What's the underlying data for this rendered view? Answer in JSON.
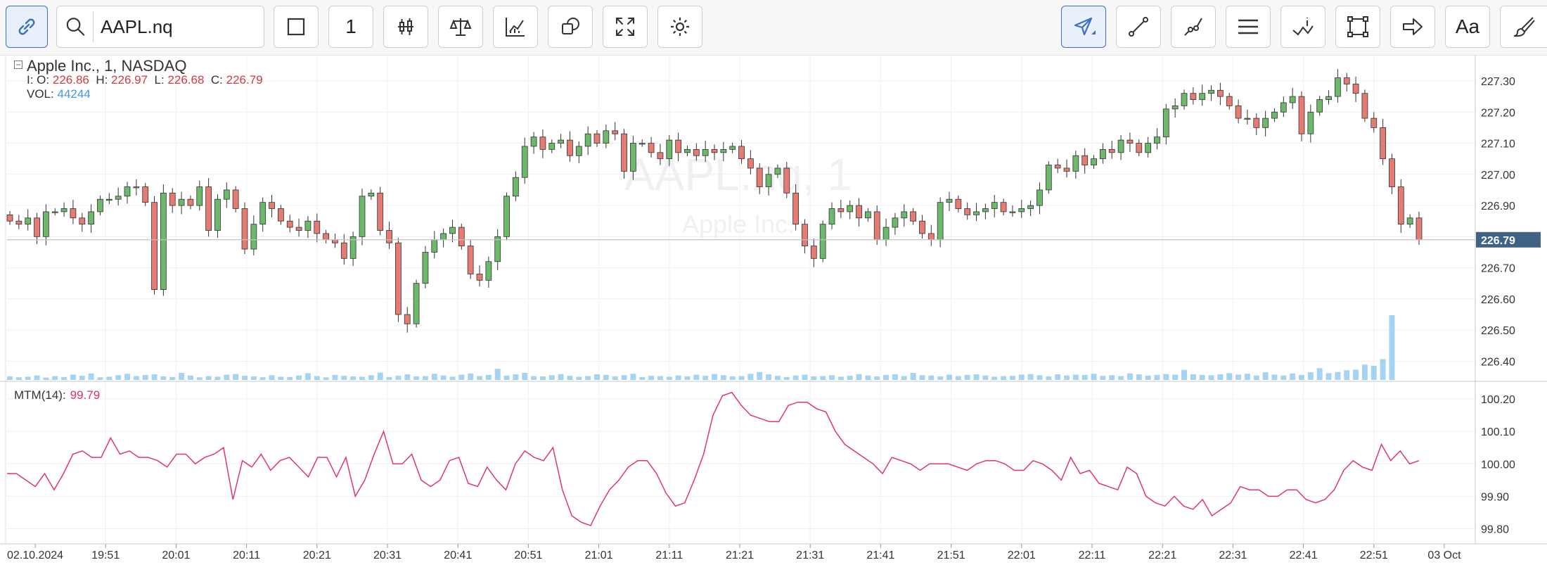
{
  "toolbar": {
    "symbol_value": "AAPL.nq",
    "interval_label": "1",
    "buttons": [
      {
        "name": "link-icon"
      },
      {
        "name": "search-icon"
      },
      {
        "name": "square-icon"
      },
      {
        "name": "candlestick-icon"
      },
      {
        "name": "scale-icon"
      },
      {
        "name": "indicators-icon"
      },
      {
        "name": "shapes-icon"
      },
      {
        "name": "fullscreen-icon"
      },
      {
        "name": "gear-icon"
      },
      {
        "name": "cursor-icon"
      },
      {
        "name": "line-icon"
      },
      {
        "name": "polyline-icon"
      },
      {
        "name": "lines-icon"
      },
      {
        "name": "info-line-icon"
      },
      {
        "name": "rectangle-icon"
      },
      {
        "name": "arrow-icon"
      },
      {
        "name": "text-icon"
      },
      {
        "name": "brush-icon"
      }
    ],
    "text_label": "Aa"
  },
  "legend": {
    "title": "Apple Inc.,  1,  NASDAQ",
    "ohlc_prefix": "I: O:",
    "open": "226.86",
    "high_label": "H:",
    "high": "226.97",
    "low_label": "L:",
    "low": "226.68",
    "close_label": "C:",
    "close": "226.79",
    "vol_label": "VOL:",
    "vol": "44244"
  },
  "watermark": {
    "symbol": "AAPL.nq, 1",
    "name": "Apple Inc."
  },
  "mtm": {
    "label": "MTM(14):",
    "value": "99.79"
  },
  "colors": {
    "up": "#6cb96c",
    "down": "#e57b73",
    "volume": "#8fc9f0",
    "mtm": "#e0366e",
    "accent": "#3e6fc2",
    "price_tag": "#3f6285"
  },
  "chart_data": [
    {
      "type": "candlestick",
      "title": "Apple Inc., 1, NASDAQ",
      "y_ticks": [
        "227.30",
        "227.20",
        "227.10",
        "227.00",
        "226.90",
        "226.80",
        "226.70",
        "226.60",
        "226.50",
        "226.40"
      ],
      "ylim": [
        226.34,
        227.37
      ],
      "last_price": "226.79",
      "x_ticks": [
        "02.10.2024",
        "19:51",
        "20:01",
        "20:11",
        "20:21",
        "20:31",
        "20:41",
        "20:51",
        "21:01",
        "21:11",
        "21:21",
        "21:31",
        "21:41",
        "21:51",
        "22:01",
        "22:11",
        "22:21",
        "22:31",
        "22:41",
        "22:51",
        "03 Oct"
      ],
      "close": [
        226.85,
        226.84,
        226.86,
        226.8,
        226.88,
        226.88,
        226.89,
        226.86,
        226.84,
        226.88,
        226.92,
        226.92,
        226.93,
        226.96,
        226.96,
        226.91,
        226.63,
        226.94,
        226.9,
        226.92,
        226.9,
        226.96,
        226.82,
        226.92,
        226.95,
        226.89,
        226.76,
        226.84,
        226.91,
        226.89,
        226.85,
        226.83,
        226.82,
        226.85,
        226.81,
        226.79,
        226.78,
        226.73,
        226.8,
        226.93,
        226.94,
        226.82,
        226.78,
        226.55,
        226.52,
        226.65,
        226.75,
        226.79,
        226.81,
        226.83,
        226.77,
        226.68,
        226.66,
        226.72,
        226.8,
        226.93,
        226.99,
        227.09,
        227.12,
        227.08,
        227.1,
        227.11,
        227.06,
        227.09,
        227.13,
        227.1,
        227.14,
        227.13,
        227.01,
        227.1,
        227.1,
        227.07,
        227.05,
        227.11,
        227.07,
        227.08,
        227.06,
        227.08,
        227.07,
        227.08,
        227.09,
        227.05,
        227.02,
        226.96,
        227.0,
        227.02,
        226.94,
        226.84,
        226.77,
        226.73,
        226.84,
        226.89,
        226.88,
        226.9,
        226.86,
        226.88,
        226.79,
        226.83,
        226.86,
        226.88,
        226.85,
        226.81,
        226.79,
        226.91,
        226.92,
        226.89,
        226.87,
        226.88,
        226.89,
        226.91,
        226.88,
        226.88,
        226.89,
        226.9,
        226.95,
        227.03,
        227.02,
        227.01,
        227.06,
        227.03,
        227.05,
        227.08,
        227.07,
        227.11,
        227.1,
        227.07,
        227.1,
        227.12,
        227.21,
        227.22,
        227.26,
        227.24,
        227.26,
        227.27,
        227.25,
        227.22,
        227.18,
        227.18,
        227.15,
        227.18,
        227.2,
        227.23,
        227.25,
        227.13,
        227.2,
        227.24,
        227.25,
        227.31,
        227.29,
        227.26,
        227.18,
        227.15,
        227.05,
        226.96,
        226.84,
        226.86,
        226.79
      ],
      "volume": [
        1200,
        900,
        1100,
        1500,
        800,
        1300,
        1000,
        1800,
        1400,
        2200,
        900,
        1100,
        1600,
        2100,
        1300,
        1700,
        1900,
        1200,
        1000,
        2400,
        1500,
        900,
        1300,
        1100,
        1800,
        2000,
        1400,
        1200,
        900,
        1600,
        1100,
        1000,
        1500,
        2300,
        1300,
        900,
        1700,
        1400,
        1200,
        1100,
        1600,
        2500,
        1000,
        1400,
        1900,
        1200,
        1300,
        2100,
        1500,
        1100,
        1800,
        2200,
        1300,
        1700,
        3800,
        1500,
        1900,
        2400,
        1300,
        1200,
        1600,
        2000,
        1400,
        1100,
        1300,
        1900,
        1700,
        1200,
        1600,
        2100,
        1000,
        1400,
        1300,
        1100,
        1500,
        1200,
        1800,
        1400,
        2000,
        1600,
        1200,
        1300,
        2100,
        2700,
        1900,
        1400,
        1000,
        1500,
        1800,
        1200,
        1300,
        1600,
        1100,
        1400,
        2000,
        1500,
        1200,
        1700,
        1900,
        1300,
        2400,
        1600,
        1500,
        1200,
        1800,
        1300,
        1700,
        1900,
        1500,
        1100,
        1300,
        1400,
        1800,
        2000,
        1600,
        1200,
        1900,
        1500,
        1800,
        1700,
        2100,
        1400,
        1600,
        1300,
        2200,
        1900,
        1500,
        1700,
        2000,
        1800,
        3400,
        1900,
        1700,
        1600,
        1900,
        2300,
        1800,
        2100,
        1500,
        2600,
        1800,
        1500,
        2200,
        1700,
        2600,
        4000,
        2300,
        2700,
        3300,
        3500,
        5200,
        4800,
        7100,
        22000
      ],
      "series": [
        {
          "name": "VOL",
          "values_ref": "volume"
        }
      ]
    },
    {
      "type": "line",
      "title": "MTM(14)",
      "y_ticks": [
        "100.20",
        "100.10",
        "100.00",
        "99.90",
        "99.80"
      ],
      "ylim": [
        99.76,
        100.25
      ],
      "values": [
        99.97,
        99.97,
        99.95,
        99.93,
        99.97,
        99.92,
        99.97,
        100.03,
        100.04,
        100.02,
        100.02,
        100.08,
        100.03,
        100.04,
        100.02,
        100.02,
        100.01,
        99.99,
        100.03,
        100.03,
        100.0,
        100.02,
        100.03,
        100.05,
        99.89,
        100.01,
        99.99,
        100.03,
        99.98,
        100.01,
        100.02,
        99.99,
        99.96,
        100.02,
        100.02,
        99.96,
        100.02,
        99.9,
        99.95,
        100.03,
        100.1,
        100.0,
        100.0,
        100.03,
        99.95,
        99.93,
        99.95,
        100.01,
        100.02,
        99.94,
        99.93,
        99.99,
        99.95,
        99.92,
        100.0,
        100.04,
        100.02,
        100.01,
        100.05,
        99.92,
        99.84,
        99.82,
        99.81,
        99.87,
        99.92,
        99.95,
        99.99,
        100.01,
        100.01,
        99.97,
        99.91,
        99.87,
        99.88,
        99.95,
        100.03,
        100.15,
        100.21,
        100.22,
        100.18,
        100.15,
        100.14,
        100.13,
        100.13,
        100.18,
        100.19,
        100.19,
        100.17,
        100.16,
        100.1,
        100.06,
        100.04,
        100.02,
        100.0,
        99.97,
        100.02,
        100.01,
        100.0,
        99.98,
        100.0,
        100.0,
        100.0,
        99.99,
        99.98,
        100.0,
        100.01,
        100.01,
        100.0,
        99.98,
        99.98,
        100.01,
        100.0,
        99.98,
        99.95,
        100.02,
        99.97,
        99.98,
        99.94,
        99.93,
        99.92,
        99.99,
        99.97,
        99.9,
        99.88,
        99.87,
        99.9,
        99.87,
        99.86,
        99.89,
        99.84,
        99.86,
        99.88,
        99.93,
        99.92,
        99.92,
        99.9,
        99.9,
        99.92,
        99.92,
        99.89,
        99.88,
        99.89,
        99.92,
        99.98,
        100.01,
        99.99,
        99.98,
        100.06,
        100.01,
        100.04,
        100.0,
        100.01
      ],
      "series": [
        {
          "name": "MTM(14)"
        }
      ]
    }
  ]
}
